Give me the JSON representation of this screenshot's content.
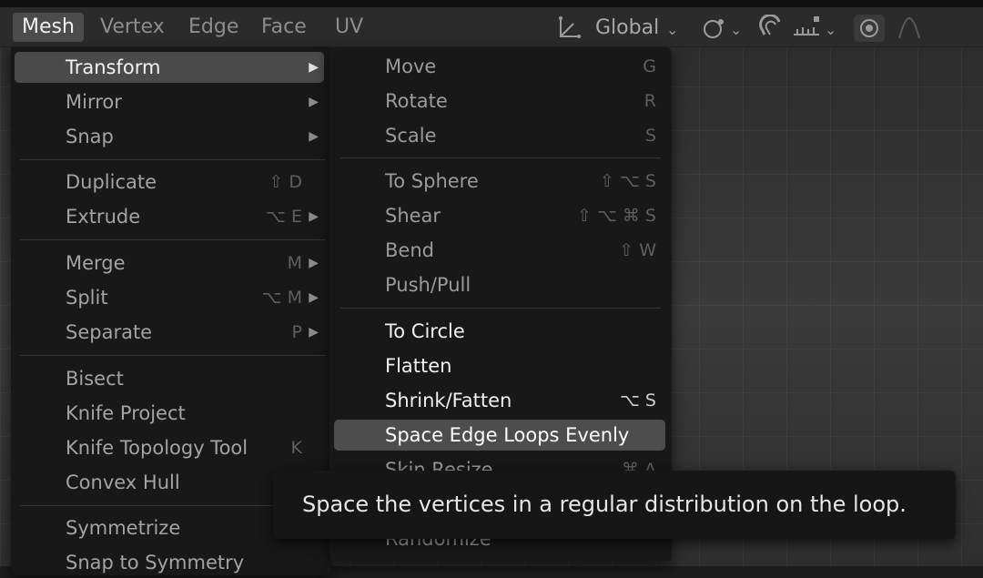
{
  "header": {
    "menus": [
      "Mesh",
      "Vertex",
      "Edge",
      "Face",
      "UV"
    ],
    "orientation": "Global",
    "icons": {
      "transform_orientation": "transform-orientation-icon",
      "pivot": "pivot-point-icon",
      "snap": "magnet-snap-icon",
      "snap_increment": "snap-increment-icon",
      "proportional_edit": "proportional-edit-icon",
      "falloff": "falloff-curve-icon"
    }
  },
  "main_menu": {
    "items": [
      {
        "label": "Transform",
        "shortcut": "",
        "submenu": true,
        "active": true
      },
      {
        "label": "Mirror",
        "shortcut": "",
        "submenu": true
      },
      {
        "label": "Snap",
        "shortcut": "",
        "submenu": true
      },
      {
        "label": "Duplicate",
        "shortcut": "⇧ D",
        "submenu": false
      },
      {
        "label": "Extrude",
        "shortcut": "⌥ E",
        "submenu": true
      },
      {
        "label": "Merge",
        "shortcut": "M",
        "submenu": true
      },
      {
        "label": "Split",
        "shortcut": "⌥ M",
        "submenu": true
      },
      {
        "label": "Separate",
        "shortcut": "P",
        "submenu": true
      },
      {
        "label": "Bisect",
        "shortcut": "",
        "submenu": false
      },
      {
        "label": "Knife Project",
        "shortcut": "",
        "submenu": false
      },
      {
        "label": "Knife Topology Tool",
        "shortcut": "K",
        "submenu": false
      },
      {
        "label": "Convex Hull",
        "shortcut": "",
        "submenu": false
      },
      {
        "label": "Symmetrize",
        "shortcut": "",
        "submenu": false
      },
      {
        "label": "Snap to Symmetry",
        "shortcut": "",
        "submenu": false
      }
    ]
  },
  "submenu": {
    "items": [
      {
        "label": "Move",
        "shortcut": "G"
      },
      {
        "label": "Rotate",
        "shortcut": "R"
      },
      {
        "label": "Scale",
        "shortcut": "S"
      },
      {
        "label": "To Sphere",
        "shortcut": "⇧ ⌥ S"
      },
      {
        "label": "Shear",
        "shortcut": "⇧ ⌥ ⌘ S"
      },
      {
        "label": "Bend",
        "shortcut": "⇧ W"
      },
      {
        "label": "Push/Pull",
        "shortcut": ""
      },
      {
        "label": "To Circle",
        "shortcut": ""
      },
      {
        "label": "Flatten",
        "shortcut": ""
      },
      {
        "label": "Shrink/Fatten",
        "shortcut": "⌥ S"
      },
      {
        "label": "Space Edge Loops Evenly",
        "shortcut": ""
      },
      {
        "label": "Skin Resize",
        "shortcut": "⌘ A"
      },
      {
        "label": "Randomize",
        "shortcut": ""
      }
    ]
  },
  "tooltip": "Space the vertices in a regular distribution on the loop."
}
